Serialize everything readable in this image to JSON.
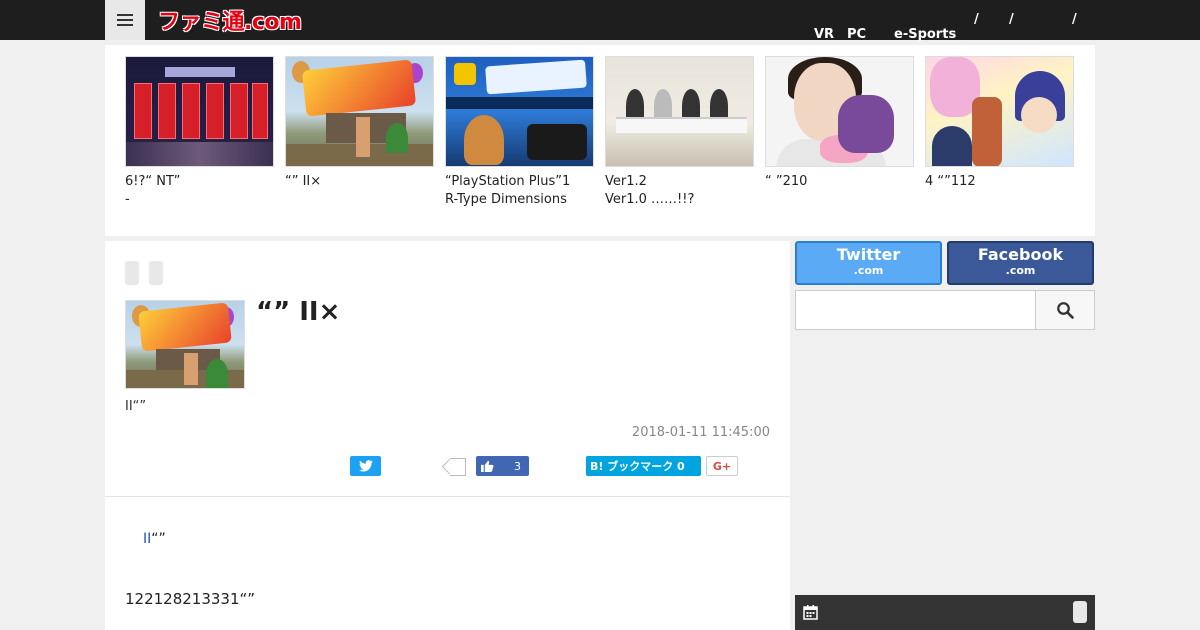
{
  "header": {
    "logo_text": "ファミ通.com",
    "nav": [
      {
        "label": "VR"
      },
      {
        "label": "PC"
      },
      {
        "label": "e-Sports"
      },
      {
        "label": "/"
      },
      {
        "label": "/"
      },
      {
        "label": "/"
      }
    ]
  },
  "carousel": {
    "items": [
      {
        "line1": "6!?“  NT”",
        "line2": "-"
      },
      {
        "line1": "“” II×",
        "line2": ""
      },
      {
        "line1": "“PlayStation Plus”1",
        "line2": "R-Type Dimensions"
      },
      {
        "line1": " Ver1.2",
        "line2": "Ver1.0 ……!!?"
      },
      {
        "line1": "“ ”210",
        "line2": ""
      },
      {
        "line1": "4 “”112",
        "line2": ""
      }
    ]
  },
  "article": {
    "title": "“” II×",
    "lead": "II“”",
    "date": "2018-01-11 11:45:00",
    "share": {
      "like_count": "3",
      "hatena_label": "B! ブックマーク 0",
      "gplus_label": "G+"
    },
    "body_link": "II",
    "body_link_suffix": "“”",
    "body_text": "122128213331“”"
  },
  "sidebar": {
    "twitter": {
      "name": "Twitter",
      "sub": ".com"
    },
    "facebook": {
      "name": "Facebook",
      "sub": ".com"
    },
    "search_value": "",
    "search_placeholder": ""
  },
  "colors": {
    "topbar": "#1e1e1e",
    "logo": "#e60012",
    "twitter": "#1da1f2",
    "facebook": "#3b5998",
    "hatena": "#00a4de",
    "link": "#1a56b4"
  }
}
